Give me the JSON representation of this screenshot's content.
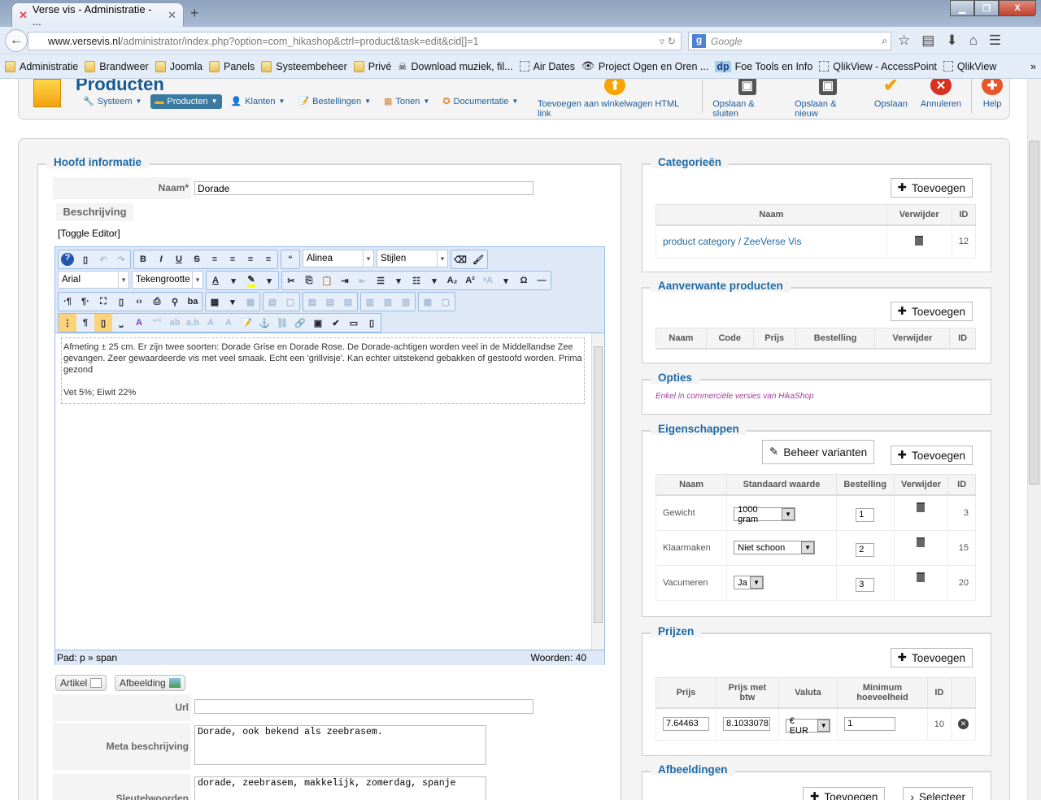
{
  "browser": {
    "tab_title": "Verse vis - Administratie - ...",
    "url_domain": "www.versevis.nl",
    "url_prefix": "",
    "url_path": "/administrator/index.php?option=com_hikashop&ctrl=product&task=edit&cid[]=1",
    "search_placeholder": "Google",
    "bookmarks": [
      "Administratie",
      "Brandweer",
      "Joomla",
      "Panels",
      "Systeembeheer",
      "Privé",
      "Download muziek, fil...",
      "Air Dates",
      "Project Ogen en Oren ...",
      "Foe Tools en Info",
      "QlikView - AccessPoint",
      "QlikView"
    ],
    "bookmark_more": "»"
  },
  "header": {
    "title": "Producten",
    "menu": [
      "Systeem",
      "Producten",
      "Klanten",
      "Bestellingen",
      "Tonen",
      "Documentatie"
    ],
    "actions": [
      "Toevoegen aan winkelwagen HTML link",
      "Opslaan & sluiten",
      "Opslaan & nieuw",
      "Opslaan",
      "Annuleren",
      "Help"
    ]
  },
  "main": {
    "legend": "Hoofd informatie",
    "name_label": "Naam*",
    "name_value": "Dorade",
    "description_label": "Beschrijving",
    "toggle_editor": "[Toggle Editor]",
    "editor": {
      "format_select": "Alinea",
      "styles_select": "Stijlen",
      "font_select": "Arial",
      "size_select": "Tekengrootte",
      "paragraph1": "Afmeting ± 25 cm. Er zijn twee soorten: Dorade Grise en Dorade Rose. De Dorade-achtigen worden veel in de Middellandse Zee gevangen. Zeer gewaardeerde vis met veel smaak. Echt een 'grillvisje'. Kan echter uitstekend gebakken of gestoofd worden. Prima gezond",
      "paragraph2": "Vet 5%; Eiwit 22%",
      "path": "Pad: p » span",
      "words": "Woorden: 40"
    },
    "article_button": "Artikel",
    "image_button": "Afbeelding",
    "url_label": "Url",
    "url_value": "",
    "meta_label": "Meta beschrijving",
    "meta_value": "Dorade, ook bekend als zeebrasem.",
    "keywords_label": "Sleutelwoorden",
    "keywords_value": "dorade, zeebrasem, makkelijk, zomerdag, spanje"
  },
  "categories": {
    "legend": "Categorieën",
    "add": "Toevoegen",
    "headers": [
      "Naam",
      "Verwijder",
      "ID"
    ],
    "rows": [
      {
        "name": "product category / ZeeVerse Vis",
        "id": "12"
      }
    ]
  },
  "related": {
    "legend": "Aanverwante producten",
    "add": "Toevoegen",
    "headers": [
      "Naam",
      "Code",
      "Prijs",
      "Bestelling",
      "Verwijder",
      "ID"
    ]
  },
  "options": {
    "legend": "Opties",
    "note": "Enkel in commerciële versies van HikaShop"
  },
  "properties": {
    "legend": "Eigenschappen",
    "manage": "Beheer varianten",
    "add": "Toevoegen",
    "headers": [
      "Naam",
      "Standaard waarde",
      "Bestelling",
      "Verwijder",
      "ID"
    ],
    "rows": [
      {
        "name": "Gewicht",
        "value": "1000 gram",
        "order": "1",
        "id": "3"
      },
      {
        "name": "Klaarmaken",
        "value": "Niet schoon",
        "order": "2",
        "id": "15"
      },
      {
        "name": "Vacumeren",
        "value": "Ja",
        "order": "3",
        "id": "20"
      }
    ]
  },
  "prices": {
    "legend": "Prijzen",
    "add": "Toevoegen",
    "headers": [
      "Prijs",
      "Prijs met btw",
      "Valuta",
      "Minimum hoeveelheid",
      "ID"
    ],
    "rows": [
      {
        "price": "7.64463",
        "price_vat": "8.1033078",
        "currency": "€ EUR",
        "min_qty": "1",
        "id": "10"
      }
    ]
  },
  "images": {
    "legend": "Afbeeldingen",
    "add": "Toevoegen",
    "select": "Selecteer"
  }
}
